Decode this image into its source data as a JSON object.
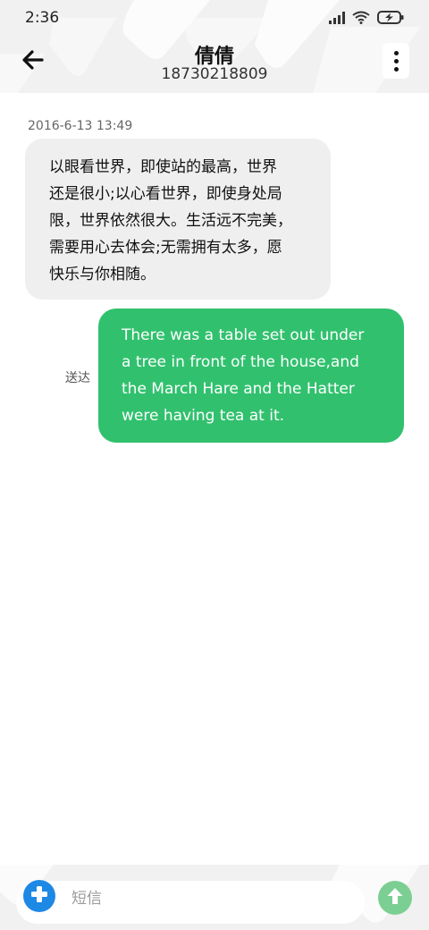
{
  "status_bar": {
    "time": "2:36",
    "icons": [
      "signal-icon",
      "wifi-icon",
      "battery-charging-icon"
    ]
  },
  "header": {
    "back_icon": "arrow-left-icon",
    "contact_name": "倩倩",
    "contact_number": "18730218809",
    "more_icon": "more-vertical-icon"
  },
  "conversation": {
    "messages": [
      {
        "direction": "incoming",
        "timestamp": "2016-6-13 13:49",
        "lines": [
          "以眼看世界，即使站的最高，世界",
          "还是很小;以心看世界，即使身处局",
          "限，世界依然很大。生活远不完美，",
          "需要用心去体会;无需拥有太多，愿",
          "快乐与你相随。"
        ]
      },
      {
        "direction": "outgoing",
        "status": "送达",
        "lines": [
          "There was a table set out under",
          "a tree in front of the house,and",
          "the March Hare and the Hatter",
          "were having tea at it."
        ]
      }
    ]
  },
  "composer": {
    "add_icon": "plus-circle-icon",
    "placeholder": "短信",
    "value": "",
    "send_icon": "arrow-up-circle-icon"
  },
  "colors": {
    "outgoing_bubble": "#31c16e",
    "incoming_bubble": "#efefef",
    "add_button": "#1e88e5",
    "send_button": "#7ccf92",
    "header_bg": "#f1f1f1"
  }
}
